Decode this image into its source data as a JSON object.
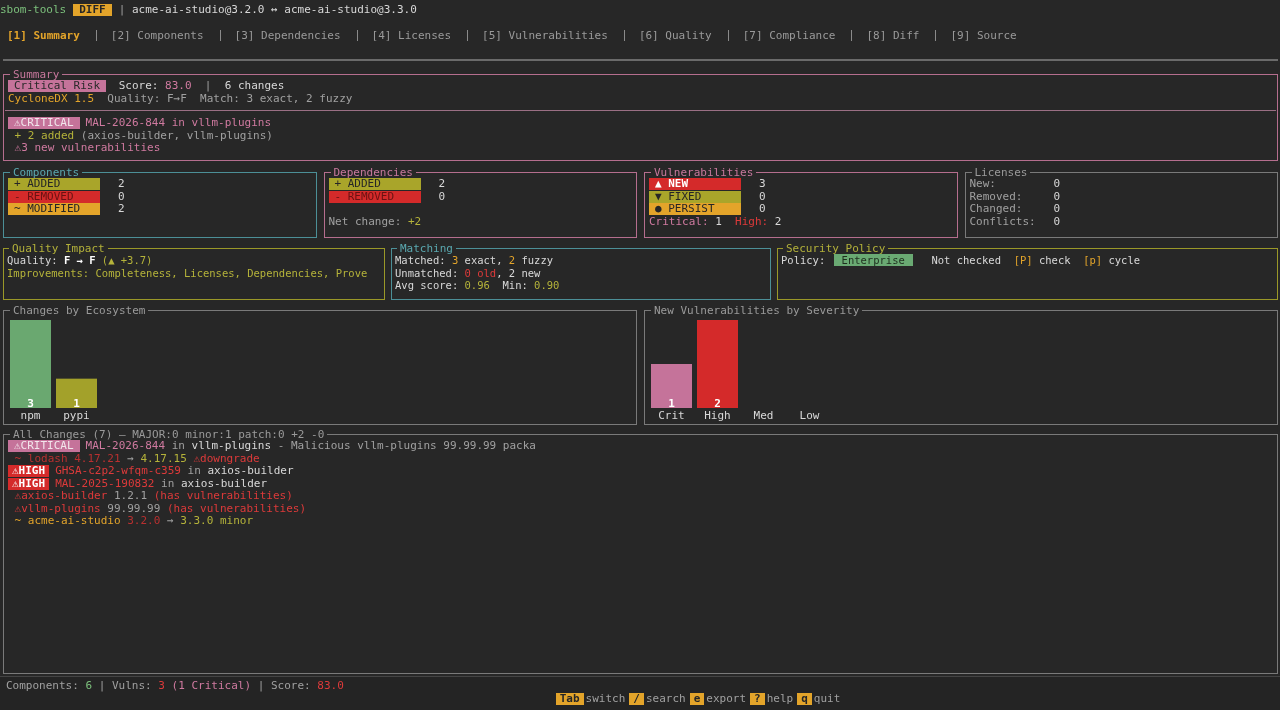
{
  "header": {
    "app": "sbom-tools",
    "mode": "DIFF",
    "title": [
      {
        "text": "| ",
        "kind": "grey"
      },
      {
        "text": "acme-ai-studio@3.2.0 ↔ acme-ai-studio@3.3.0",
        "kind": "white"
      }
    ]
  },
  "tabs": [
    {
      "label": "[1] Summary",
      "selected": true
    },
    {
      "label": "[2] Components",
      "selected": false
    },
    {
      "label": "[3] Dependencies",
      "selected": false
    },
    {
      "label": "[4] Licenses",
      "selected": false
    },
    {
      "label": "[5] Vulnerabilities",
      "selected": false
    },
    {
      "label": "[6] Quality",
      "selected": false
    },
    {
      "label": "[7] Compliance",
      "selected": false
    },
    {
      "label": "[8] Diff",
      "selected": false
    },
    {
      "label": "[9] Source",
      "selected": false
    }
  ],
  "summary": {
    "title": "Summary",
    "kind": "pink",
    "head": [
      {
        "badge": {
          "text": "Critical Risk",
          "kind": "risk"
        },
        "segments": [
          {
            "text": " Score: ",
            "kind": "white"
          },
          {
            "text": "83.0",
            "kind": "pink"
          },
          {
            "text": "  |  ",
            "kind": "grey"
          },
          {
            "text": "6 changes",
            "kind": "white"
          }
        ]
      },
      {
        "segments": [
          {
            "text": "CycloneDX 1.5",
            "kind": "yellow"
          },
          {
            "text": "  Quality: F→F  Match: 3 exact, 2 fuzzy",
            "kind": "grey"
          }
        ]
      }
    ],
    "alerts": [
      {
        "badge": {
          "text": "⚠CRITICAL",
          "kind": "critical"
        },
        "segments": [
          {
            "text": "MAL-2026-844 in vllm-plugins",
            "kind": "pink"
          }
        ]
      },
      {
        "segments": [
          {
            "text": " + 2 added",
            "kind": "olive"
          },
          {
            "text": " (axios-builder, vllm-plugins)",
            "kind": "grey"
          }
        ]
      },
      {
        "segments": [
          {
            "text": " ⚠3 new vulnerabilities",
            "kind": "pink"
          }
        ]
      }
    ]
  },
  "panels": [
    {
      "title": "Components",
      "kind": "cyan",
      "rows": [
        {
          "label": "+ ADDED",
          "kind": "added",
          "value": "2"
        },
        {
          "label": "- REMOVED",
          "kind": "removed",
          "value": "0"
        },
        {
          "label": "~ MODIFIED",
          "kind": "modified",
          "value": "2"
        }
      ]
    },
    {
      "title": "Dependencies",
      "kind": "pink",
      "rows": [
        {
          "label": "+ ADDED",
          "kind": "added",
          "value": "2"
        },
        {
          "label": "- REMOVED",
          "kind": "removed",
          "value": "0"
        }
      ],
      "footer": [
        {
          "text": "Net change: ",
          "kind": "grey"
        },
        {
          "text": "+2",
          "kind": "olive"
        }
      ]
    },
    {
      "title": "Vulnerabilities",
      "kind": "pink",
      "rows": [
        {
          "label": "▲ NEW",
          "kind": "new",
          "value": "3"
        },
        {
          "label": "▼ FIXED",
          "kind": "added",
          "value": "0"
        },
        {
          "label": "● PERSIST",
          "kind": "modified",
          "value": "0"
        }
      ],
      "footer": [
        {
          "text": "Critical:",
          "kind": "pink"
        },
        {
          "text": " 1  ",
          "kind": "white"
        },
        {
          "text": "High:",
          "kind": "red"
        },
        {
          "text": " 2",
          "kind": "white"
        }
      ]
    },
    {
      "title": "Licenses",
      "kind": "grey",
      "rows": [
        {
          "label": "New:",
          "value": "0"
        },
        {
          "label": "Removed:",
          "value": "0"
        },
        {
          "label": "Changed:",
          "value": "0"
        },
        {
          "label": "Conflicts:",
          "value": "0"
        }
      ]
    }
  ],
  "info_panels": [
    {
      "title": "Quality Impact",
      "kind": "olive",
      "lines": [
        {
          "segments": [
            {
              "text": "Quality: ",
              "kind": "white"
            },
            {
              "text": "F → F",
              "kind": "bold"
            },
            {
              "text": " (▲ +3.7)",
              "kind": "olive"
            }
          ]
        },
        {
          "segments": [
            {
              "text": "Improvements: Completeness, Licenses, Dependencies, Prove",
              "kind": "olive"
            }
          ]
        }
      ]
    },
    {
      "title": "Matching",
      "kind": "cyan",
      "lines": [
        {
          "segments": [
            {
              "text": "Matched: ",
              "kind": "white"
            },
            {
              "text": "3",
              "kind": "yellow"
            },
            {
              "text": " exact, ",
              "kind": "white"
            },
            {
              "text": "2",
              "kind": "yellow"
            },
            {
              "text": " fuzzy",
              "kind": "white"
            }
          ]
        },
        {
          "segments": [
            {
              "text": "Unmatched: ",
              "kind": "white"
            },
            {
              "text": "0 old",
              "kind": "red"
            },
            {
              "text": ", 2 new",
              "kind": "white"
            }
          ]
        },
        {
          "segments": [
            {
              "text": "Avg score: ",
              "kind": "white"
            },
            {
              "text": "0.96",
              "kind": "olive"
            },
            {
              "text": "  Min: ",
              "kind": "white"
            },
            {
              "text": "0.90",
              "kind": "olive"
            }
          ]
        }
      ]
    },
    {
      "title": "Security Policy",
      "kind": "olive",
      "lines": [
        {
          "before": [
            {
              "text": "Policy: ",
              "kind": "white"
            }
          ],
          "badge": {
            "text": "Enterprise",
            "kind": "policy"
          },
          "segments": [
            {
              "text": "  Not checked  ",
              "kind": "white"
            },
            {
              "text": "[P]",
              "kind": "yellow"
            },
            {
              "text": " check  ",
              "kind": "white"
            },
            {
              "text": "[p]",
              "kind": "yellow"
            },
            {
              "text": " cycle",
              "kind": "white"
            }
          ]
        }
      ]
    }
  ],
  "charts": [
    {
      "title": "Changes by Ecosystem",
      "chart_data": {
        "type": "bar",
        "categories": [
          "npm",
          "pypi"
        ],
        "ylim": [
          0,
          3
        ],
        "data_labels": true,
        "series": [
          {
            "color": "#6aa870",
            "values": [
              3,
              null
            ]
          },
          {
            "color": "#a3a12a",
            "values": [
              null,
              1
            ]
          }
        ]
      }
    },
    {
      "title": "New Vulnerabilities by Severity",
      "chart_data": {
        "type": "bar",
        "categories": [
          "Crit",
          "High",
          "Med",
          "Low"
        ],
        "ylim": [
          0,
          2
        ],
        "data_labels": true,
        "series": [
          {
            "color": "#c5739a",
            "values": [
              1,
              null,
              null,
              null
            ]
          },
          {
            "color": "#d42a2a",
            "values": [
              null,
              2,
              null,
              null
            ]
          }
        ]
      }
    }
  ],
  "changes": {
    "title": "All Changes (7) — MAJOR:0 minor:1 patch:0 +2 -0",
    "lines": [
      {
        "badge": {
          "text": "⚠CRITICAL",
          "kind": "critical"
        },
        "segments": [
          {
            "text": "MAL-2026-844",
            "kind": "pink"
          },
          {
            "text": " in ",
            "kind": "grey"
          },
          {
            "text": "vllm-plugins",
            "kind": "white"
          },
          {
            "text": " - Malicious vllm-plugins 99.99.99 packa",
            "kind": "grey"
          }
        ]
      },
      {
        "segments": [
          {
            "text": " ~ lodash 4.17.21",
            "kind": "darkred"
          },
          {
            "text": " → ",
            "kind": "grey"
          },
          {
            "text": "4.17.15",
            "kind": "olive"
          },
          {
            "text": " ⚠downgrade",
            "kind": "red"
          }
        ]
      },
      {
        "badge": {
          "text": "⚠HIGH",
          "kind": "high"
        },
        "segments": [
          {
            "text": "GHSA-c2p2-wfqm-c359",
            "kind": "red"
          },
          {
            "text": " in ",
            "kind": "grey"
          },
          {
            "text": "axios-builder",
            "kind": "white"
          }
        ]
      },
      {
        "badge": {
          "text": "⚠HIGH",
          "kind": "high"
        },
        "segments": [
          {
            "text": "MAL-2025-190832",
            "kind": "red"
          },
          {
            "text": " in ",
            "kind": "grey"
          },
          {
            "text": "axios-builder",
            "kind": "white"
          }
        ]
      },
      {
        "segments": [
          {
            "text": " ⚠axios-builder",
            "kind": "red"
          },
          {
            "text": " 1.2.1 ",
            "kind": "grey"
          },
          {
            "text": "(has vulnerabilities)",
            "kind": "red"
          }
        ]
      },
      {
        "segments": [
          {
            "text": " ⚠vllm-plugins",
            "kind": "red"
          },
          {
            "text": " 99.99.99 ",
            "kind": "grey"
          },
          {
            "text": "(has vulnerabilities)",
            "kind": "red"
          }
        ]
      },
      {
        "segments": [
          {
            "text": " ~ acme-ai-studio",
            "kind": "yellow"
          },
          {
            "text": " 3.2.0",
            "kind": "darkred"
          },
          {
            "text": " → ",
            "kind": "grey"
          },
          {
            "text": "3.3.0 minor",
            "kind": "olive"
          }
        ]
      }
    ]
  },
  "status": [
    {
      "text": "Components: ",
      "kind": "grey"
    },
    {
      "text": "6",
      "kind": "green"
    },
    {
      "text": " | ",
      "kind": "grey"
    },
    {
      "text": "Vulns: ",
      "kind": "grey"
    },
    {
      "text": "3",
      "kind": "red"
    },
    {
      "text": " (1 Critical)",
      "kind": "pink"
    },
    {
      "text": " | ",
      "kind": "grey"
    },
    {
      "text": "Score: ",
      "kind": "grey"
    },
    {
      "text": "83.0",
      "kind": "red"
    }
  ],
  "keys": [
    {
      "key": "Tab",
      "label": "switch"
    },
    {
      "key": "/",
      "label": "search"
    },
    {
      "key": "e",
      "label": "export"
    },
    {
      "key": "?",
      "label": "help"
    },
    {
      "key": "q",
      "label": "quit"
    }
  ]
}
